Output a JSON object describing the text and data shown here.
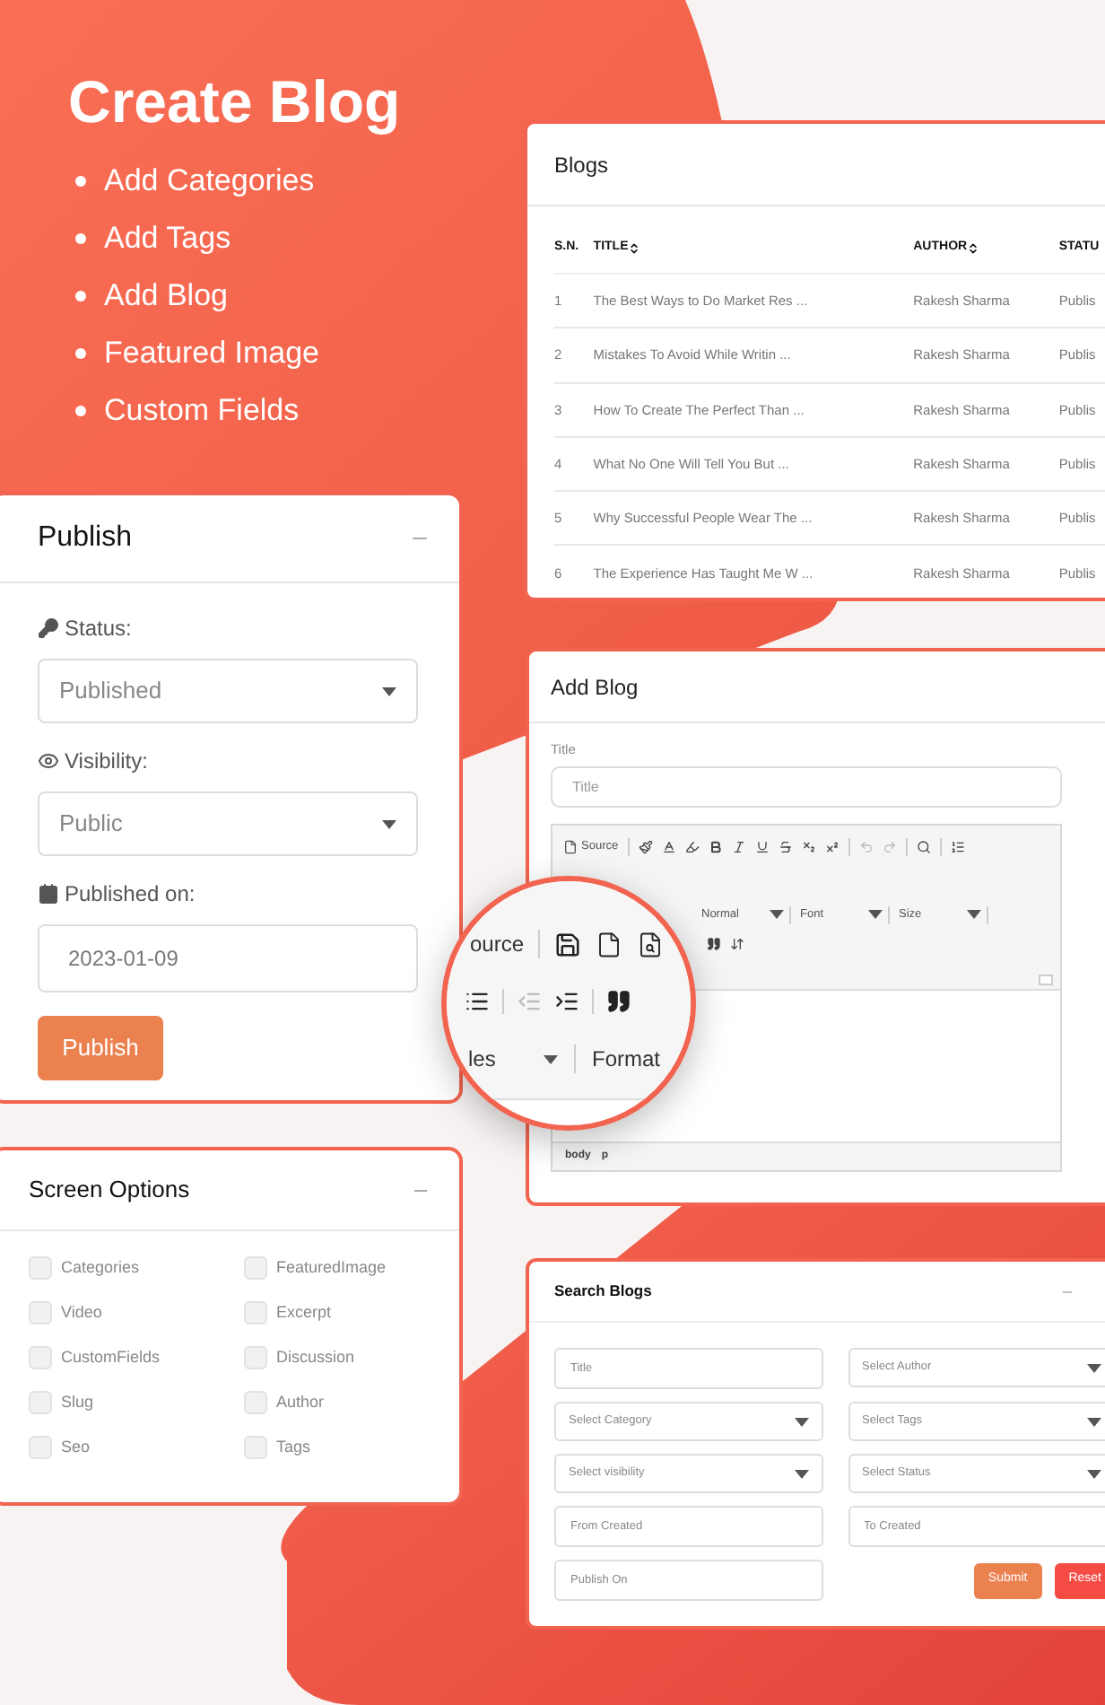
{
  "hero": {
    "title": "Create Blog",
    "features": [
      "Add Categories",
      "Add Tags",
      "Add Blog",
      "Featured Image",
      "Custom Fields"
    ]
  },
  "blogs_table": {
    "title": "Blogs",
    "columns": [
      {
        "label": "S.N.",
        "sortable": false
      },
      {
        "label": "TITLE",
        "sortable": true
      },
      {
        "label": "AUTHOR",
        "sortable": true
      },
      {
        "label": "STATU",
        "sortable": false
      }
    ],
    "rows": [
      {
        "sn": "1",
        "title": "The Best Ways to Do Market Res ...",
        "author": "Rakesh Sharma",
        "status": "Publis"
      },
      {
        "sn": "2",
        "title": "Mistakes To Avoid While Writin ...",
        "author": "Rakesh Sharma",
        "status": "Publis"
      },
      {
        "sn": "3",
        "title": "How To Create The Perfect Than ...",
        "author": "Rakesh Sharma",
        "status": "Publis"
      },
      {
        "sn": "4",
        "title": "What No One Will Tell You But ...",
        "author": "Rakesh Sharma",
        "status": "Publis"
      },
      {
        "sn": "5",
        "title": "Why Successful People Wear The ...",
        "author": "Rakesh Sharma",
        "status": "Publis"
      },
      {
        "sn": "6",
        "title": "The Experience Has Taught Me W ...",
        "author": "Rakesh Sharma",
        "status": "Publis"
      }
    ]
  },
  "publish_panel": {
    "title": "Publish",
    "fields": [
      {
        "kind": "select",
        "label": "Status:",
        "value": "Published"
      },
      {
        "kind": "select",
        "label": "Visibility:",
        "value": "Public"
      },
      {
        "kind": "date",
        "label": "Published on:",
        "value": "2023-01-09"
      }
    ],
    "button": "Publish"
  },
  "add_blog": {
    "title": "Add Blog",
    "title_label": "Title",
    "title_placeholder": "Title",
    "editor": {
      "source_label": "Source",
      "dropdowns": [
        "Normal",
        "Font",
        "Size"
      ],
      "path": [
        "body",
        "p"
      ]
    }
  },
  "magnifier": {
    "source_label": "ource",
    "styles_label": "les",
    "format_label": "Format"
  },
  "screen_options": {
    "title": "Screen Options",
    "options": [
      {
        "label": "Categories",
        "checked": false
      },
      {
        "label": "FeaturedImage",
        "checked": false
      },
      {
        "label": "Video",
        "checked": false
      },
      {
        "label": "Excerpt",
        "checked": false
      },
      {
        "label": "CustomFields",
        "checked": false
      },
      {
        "label": "Discussion",
        "checked": false
      },
      {
        "label": "Slug",
        "checked": false
      },
      {
        "label": "Author",
        "checked": false
      },
      {
        "label": "Seo",
        "checked": false
      },
      {
        "label": "Tags",
        "checked": false
      }
    ]
  },
  "search_blogs": {
    "title": "Search Blogs",
    "fields": [
      {
        "kind": "input",
        "placeholder": "Title"
      },
      {
        "kind": "select",
        "placeholder": "Select Author"
      },
      {
        "kind": "select",
        "placeholder": "Select Category"
      },
      {
        "kind": "select",
        "placeholder": "Select Tags"
      },
      {
        "kind": "select",
        "placeholder": "Select visibility"
      },
      {
        "kind": "select",
        "placeholder": "Select Status"
      },
      {
        "kind": "input",
        "placeholder": "From Created"
      },
      {
        "kind": "input",
        "placeholder": "To Created"
      },
      {
        "kind": "input",
        "placeholder": "Publish On"
      }
    ],
    "buttons": [
      {
        "label": "Submit",
        "kind": "primary"
      },
      {
        "label": "Reset",
        "kind": "danger"
      }
    ]
  }
}
